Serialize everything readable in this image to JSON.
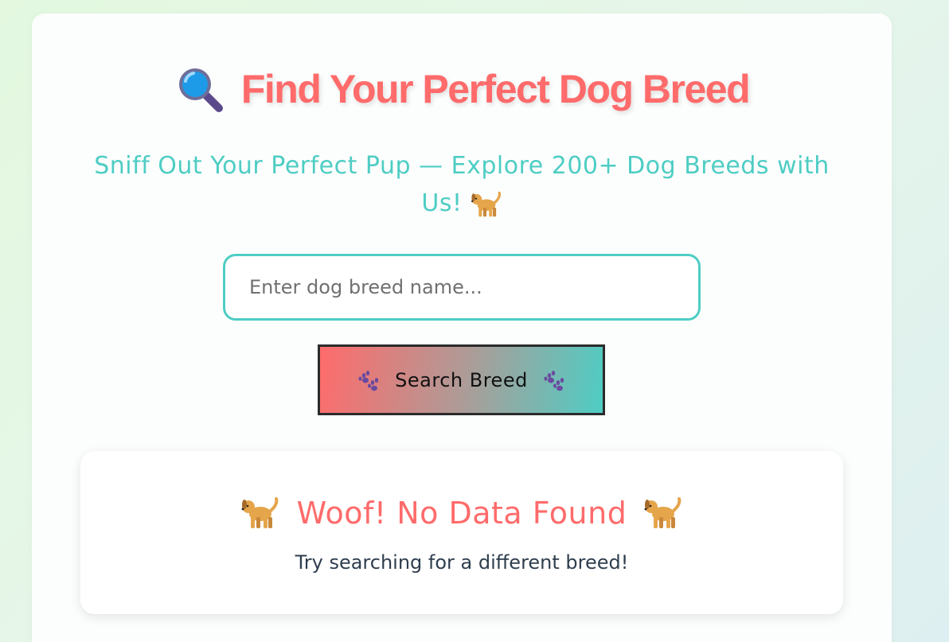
{
  "header": {
    "title": "Find Your Perfect Dog Breed",
    "title_icon": "magnifier-icon",
    "subtitle": "Sniff Out Your Perfect Pup — Explore 200+ Dog Breeds with Us!",
    "subtitle_icon": "dog-icon"
  },
  "search": {
    "value": "",
    "placeholder": "Enter dog breed name...",
    "button_label": "Search Breed",
    "button_icon": "paw-prints-icon"
  },
  "result": {
    "title": "Woof! No Data Found",
    "title_icon": "dog-icon",
    "message": "Try searching for a different breed!"
  },
  "colors": {
    "accent_coral": "#ff6b6b",
    "accent_teal": "#4ecdc4",
    "text_dark": "#2f3e4e"
  }
}
